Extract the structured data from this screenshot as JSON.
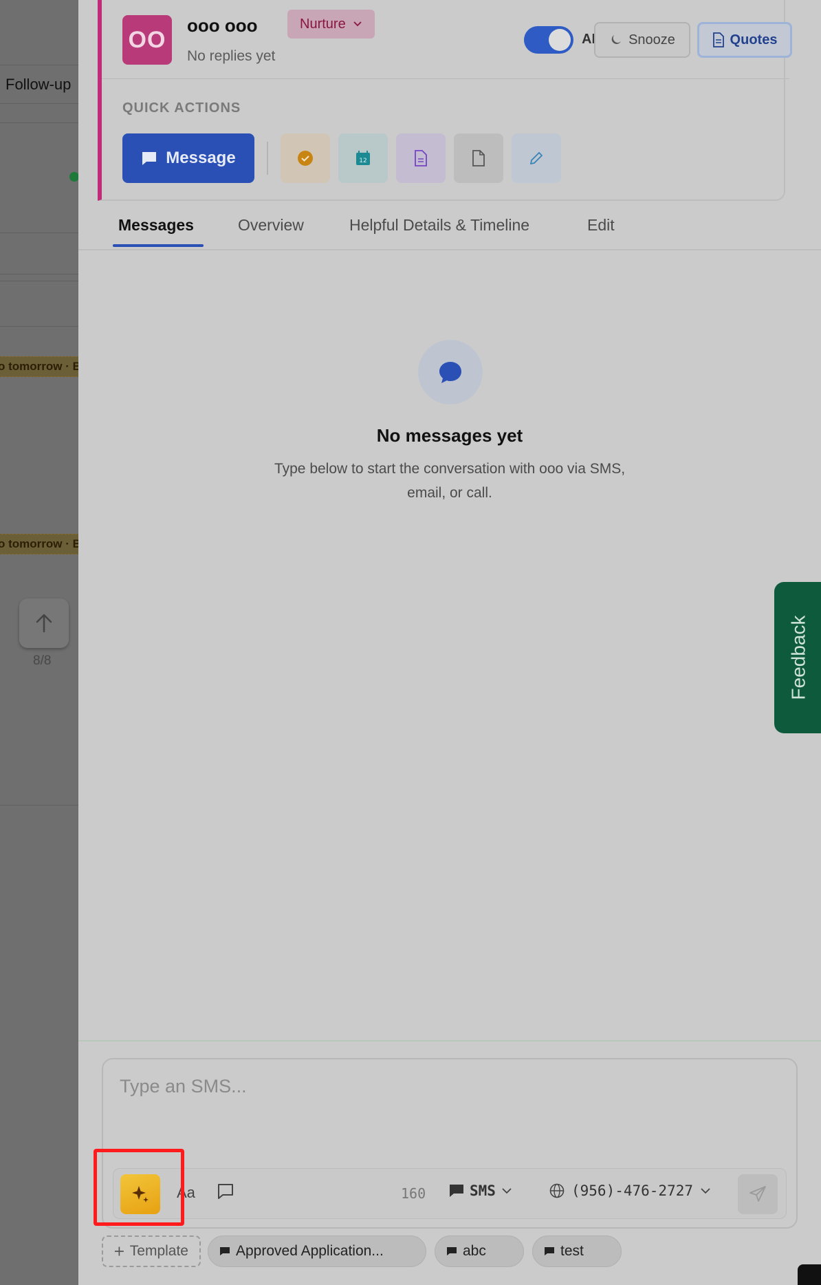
{
  "background_page": {
    "follow_up_label": "Follow-up",
    "tomorrow_labels": [
      "o tomorrow · B",
      "o tomorrow · B"
    ],
    "scroll_count": "8/8"
  },
  "contact": {
    "initials": "OO",
    "name": "ooo ooo",
    "stage": "Nurture",
    "reply_status": "No replies yet",
    "ai_label": "AI",
    "ai_enabled": true,
    "snooze_label": "Snooze",
    "quotes_label": "Quotes"
  },
  "quick_actions": {
    "title": "QUICK ACTIONS",
    "message_label": "Message",
    "icons": [
      "task-check-icon",
      "calendar-icon",
      "document-icon",
      "file-icon",
      "edit-pencil-icon"
    ]
  },
  "tabs": [
    {
      "label": "Messages",
      "active": true
    },
    {
      "label": "Overview",
      "active": false
    },
    {
      "label": "Helpful Details & Timeline",
      "active": false
    },
    {
      "label": "Edit",
      "active": false
    }
  ],
  "empty_state": {
    "title": "No messages yet",
    "subtitle": "Type below to start the conversation with ooo via SMS, email, or call."
  },
  "feedback_label": "Feedback",
  "composer": {
    "placeholder": "Type an SMS...",
    "format_label": "Aa",
    "char_count": "160",
    "channel": "SMS",
    "phone": "(956)-476-2727"
  },
  "templates": {
    "add_label": "Template",
    "chips": [
      "Approved Application...",
      "abc",
      "test"
    ]
  },
  "colors": {
    "accent": "#2a4fb5",
    "avatar": "#b83a78",
    "highlight": "#ff1b1b",
    "feedback": "#0e5a3c"
  }
}
